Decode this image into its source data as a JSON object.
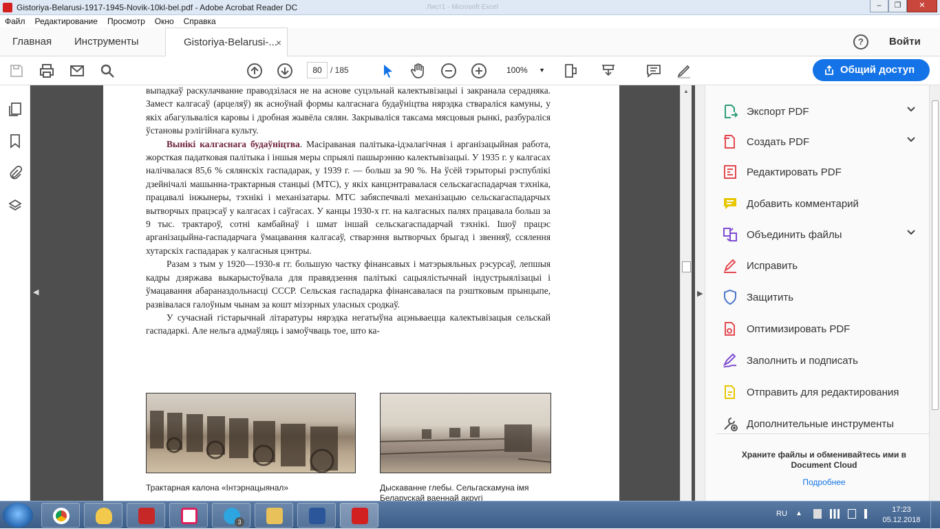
{
  "window": {
    "title": "Gistoriya-Belarusi-1917-1945-Novik-10kl-bel.pdf - Adobe Acrobat Reader DC",
    "ghost_title": "Лист1 - Microsoft Excel"
  },
  "menu": [
    "Файл",
    "Редактирование",
    "Просмотр",
    "Окно",
    "Справка"
  ],
  "tabs": {
    "home": "Главная",
    "tools": "Инструменты",
    "doc": "Gistoriya-Belarusi-...",
    "close": "×"
  },
  "header": {
    "help": "?",
    "signin": "Войти"
  },
  "toolbar": {
    "page_current": "80",
    "page_total": "/ 185",
    "zoom": "100%",
    "share": "Общий доступ"
  },
  "document": {
    "p1": "выпадкаў раскулачванне праводзілася не на аснове суцэльнай калектывізацыі і закранала серадняка. Замест калгасаў (арцеляў) як асноўнай формы калгаснага будаўніцтва нярэдка стваралiся камуны, у якiх абагульваліся каровы і дробная жывёла сялян. Закрываліся таксама мясцовыя рынкі, разбураліся ўстановы рэлігійнага культу.",
    "p2_head": "Вынікі калгаснага будаўніцтва",
    "p2_body": ". Масіраваная палітыка-ідэалагічная і арганізацыйная работа, жорсткая падатковая палітыка і іншыя меры спрыялі пашырэнню калектывізацыі. У 1935 г. у калгасах налічвалася 85,6 % сялянскіх гаспадарак, у 1939 г. — больш за 90 %. На ўсёй тэрыторыі рэспублікі дзейнічалі машынна-трактарныя станцыі (МТС), у якіх канцэнтравалася сельскагаспадарчая тэхніка, працавалі інжынеры, тэхнікі і механізатары. МТС забяспечвалі механізацыю сельскагаспадарчых вытворчых працэсаў у калгасах і саўгасах. У канцы 1930-х гг. на калгасных палях працавала больш за 9 тыс. трактароў, сотні камбайнаў і шмат іншай сельскагаспадарчай тэхнікі. Ішоў працэс арганізацыйна-гаспадарчага ўмацавання калгасаў, стварэння вытворчых брыгад і звенняў, ссялення хутарскіх гаспадарак у калгасныя цэнтры.",
    "p3": "Разам з тым у 1920—1930-я гг. большую частку фінансавых і матэрыяльных рэсурсаў, лепшыя кадры дзяржава выкарыстоўвала для правядзення палітыкі сацыялістычнай індустрыялізацыі і ўмацавання абараназдольнасці СССР. Сельская гаспадарка фінансавалася па рэштковым прынцыпе, развівалася галоўным чынам за кошт мізэрных уласных сродкаў.",
    "p4": "У сучаснай гістарычнай літаратуры нярэдка негатыўна ацэньваецца калектывізацыя сельскай гаспадаркі. Але нельга адмаўляць і замоўчваць тое, што ка-",
    "caption1": "Трактарная калона «Інтэрнацыянал»",
    "caption2": "Дыскаванне глебы. Сельгаскамуна імя Беларускай ваеннай акругі"
  },
  "right_panel": {
    "items": [
      {
        "label": "Экспорт PDF",
        "icon": "export-pdf-icon",
        "color": "#2d9d78",
        "expand": true
      },
      {
        "label": "Создать PDF",
        "icon": "create-pdf-icon",
        "color": "#e34850",
        "expand": true
      },
      {
        "label": "Редактировать PDF",
        "icon": "edit-pdf-icon",
        "color": "#e34850",
        "expand": false
      },
      {
        "label": "Добавить комментарий",
        "icon": "comment-icon",
        "color": "#e8c600",
        "expand": false
      },
      {
        "label": "Объединить файлы",
        "icon": "combine-files-icon",
        "color": "#7e4dd2",
        "expand": true
      },
      {
        "label": "Исправить",
        "icon": "fill-sign-pen-icon",
        "color": "#e34850",
        "expand": false
      },
      {
        "label": "Защитить",
        "icon": "shield-icon",
        "color": "#4b75c9",
        "expand": false
      },
      {
        "label": "Оптимизировать PDF",
        "icon": "optimize-pdf-icon",
        "color": "#e34850",
        "expand": false
      },
      {
        "label": "Заполнить и подписать",
        "icon": "fill-sign-icon",
        "color": "#7e4dd2",
        "expand": false
      },
      {
        "label": "Отправить для редактирования",
        "icon": "send-review-icon",
        "color": "#e8c600",
        "expand": false
      },
      {
        "label": "Дополнительные инструменты",
        "icon": "more-tools-icon",
        "color": "#555555",
        "expand": false
      }
    ],
    "cloud_text": "Храните файлы и обменивайтесь ими в Document Cloud",
    "more_link": "Подробнее"
  },
  "taskbar": {
    "lang": "RU",
    "time": "17:23",
    "date": "05.12.2018",
    "telegram_badge": "3"
  }
}
